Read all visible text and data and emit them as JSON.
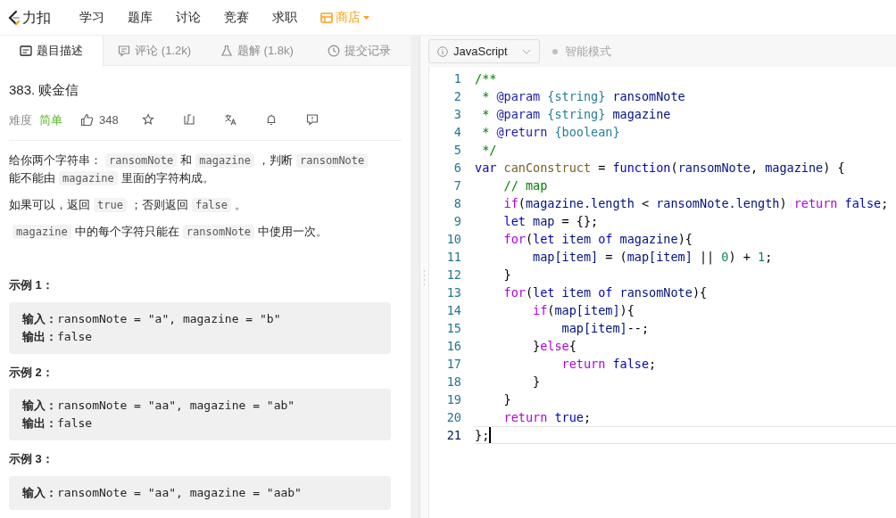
{
  "nav": {
    "logo": "力扣",
    "items": [
      {
        "label": "学习",
        "kind": "plain"
      },
      {
        "label": "题库",
        "kind": "plain"
      },
      {
        "label": "讨论",
        "kind": "plain"
      },
      {
        "label": "竞赛",
        "kind": "plain"
      },
      {
        "label": "求职",
        "kind": "plain"
      },
      {
        "label": "商店",
        "kind": "store"
      }
    ]
  },
  "tabs": [
    {
      "label": "题目描述",
      "selected": true
    },
    {
      "label": "评论 (1.2k)",
      "selected": false
    },
    {
      "label": "题解 (1.8k)",
      "selected": false
    },
    {
      "label": "提交记录",
      "selected": false
    }
  ],
  "editor_toolbar": {
    "language": "JavaScript",
    "mode": "智能模式"
  },
  "problem": {
    "title": "383. 赎金信",
    "difficulty_label": "难度",
    "difficulty": "简单",
    "likes": "348",
    "paragraphs": [
      [
        {
          "kind": "text",
          "text": "给你两个字符串："
        },
        {
          "kind": "code",
          "text": "ransomNote"
        },
        {
          "kind": "text",
          "text": "和"
        },
        {
          "kind": "code",
          "text": "magazine"
        },
        {
          "kind": "text",
          "text": "，判断"
        },
        {
          "kind": "code",
          "text": "ransomNote"
        },
        {
          "kind": "text",
          "text": "能不能由"
        },
        {
          "kind": "code",
          "text": "magazine"
        },
        {
          "kind": "text",
          "text": "里面的字符构成。"
        }
      ],
      [
        {
          "kind": "text",
          "text": "如果可以，返回"
        },
        {
          "kind": "code",
          "text": "true"
        },
        {
          "kind": "text",
          "text": "；否则返回"
        },
        {
          "kind": "code",
          "text": "false"
        },
        {
          "kind": "text",
          "text": "。"
        }
      ],
      [
        {
          "kind": "code",
          "text": "magazine"
        },
        {
          "kind": "text",
          "text": "中的每个字符只能在"
        },
        {
          "kind": "code",
          "text": "ransomNote"
        },
        {
          "kind": "text",
          "text": "中使用一次。"
        }
      ]
    ],
    "examples": [
      {
        "title": "示例 1：",
        "lines": [
          "**输入：**ransomNote = \"a\", magazine = \"b\"",
          "**输出：**false"
        ]
      },
      {
        "title": "示例 2：",
        "lines": [
          "**输入：**ransomNote = \"aa\", magazine = \"ab\"",
          "**输出：**false"
        ]
      },
      {
        "title": "示例 3：",
        "lines": [
          "**输入：**ransomNote = \"aa\", magazine = \"aab\""
        ]
      }
    ]
  },
  "code": [
    {
      "number": "1",
      "current": false,
      "tokens": [
        {
          "kind": "comment",
          "text": "/**"
        }
      ]
    },
    {
      "number": "2",
      "current": false,
      "tokens": [
        {
          "kind": "comment",
          "text": " * "
        },
        {
          "kind": "tag",
          "text": "@param "
        },
        {
          "kind": "type",
          "text": "{string} "
        },
        {
          "kind": "name",
          "text": "ransomNote"
        }
      ]
    },
    {
      "number": "3",
      "current": false,
      "tokens": [
        {
          "kind": "comment",
          "text": " * "
        },
        {
          "kind": "tag",
          "text": "@param "
        },
        {
          "kind": "type",
          "text": "{string} "
        },
        {
          "kind": "name",
          "text": "magazine"
        }
      ]
    },
    {
      "number": "4",
      "current": false,
      "tokens": [
        {
          "kind": "comment",
          "text": " * "
        },
        {
          "kind": "tag",
          "text": "@return "
        },
        {
          "kind": "type",
          "text": "{boolean}"
        }
      ]
    },
    {
      "number": "5",
      "current": false,
      "tokens": [
        {
          "kind": "comment",
          "text": " */"
        }
      ]
    },
    {
      "number": "6",
      "current": false,
      "tokens": [
        {
          "kind": "keyword",
          "text": "var "
        },
        {
          "kind": "function",
          "text": "canConstruct"
        },
        {
          "kind": "plain",
          "text": " = "
        },
        {
          "kind": "keyword",
          "text": "function"
        },
        {
          "kind": "plain",
          "text": "("
        },
        {
          "kind": "name",
          "text": "ransomNote"
        },
        {
          "kind": "plain",
          "text": ", "
        },
        {
          "kind": "name",
          "text": "magazine"
        },
        {
          "kind": "plain",
          "text": ") {"
        }
      ]
    },
    {
      "number": "7",
      "current": false,
      "tokens": [
        {
          "kind": "comment",
          "text": "    // map"
        }
      ]
    },
    {
      "number": "8",
      "current": false,
      "tokens": [
        {
          "kind": "control",
          "text": "    if"
        },
        {
          "kind": "plain",
          "text": "("
        },
        {
          "kind": "name",
          "text": "magazine.length"
        },
        {
          "kind": "plain",
          "text": " < "
        },
        {
          "kind": "name",
          "text": "ransomNote.length"
        },
        {
          "kind": "plain",
          "text": ") "
        },
        {
          "kind": "control",
          "text": "return "
        },
        {
          "kind": "keyword",
          "text": "false"
        },
        {
          "kind": "plain",
          "text": ";"
        }
      ]
    },
    {
      "number": "9",
      "current": false,
      "tokens": [
        {
          "kind": "keyword",
          "text": "    let "
        },
        {
          "kind": "name",
          "text": "map"
        },
        {
          "kind": "plain",
          "text": " = {};"
        }
      ]
    },
    {
      "number": "10",
      "current": false,
      "tokens": [
        {
          "kind": "control",
          "text": "    for"
        },
        {
          "kind": "plain",
          "text": "("
        },
        {
          "kind": "keyword",
          "text": "let "
        },
        {
          "kind": "name",
          "text": "item "
        },
        {
          "kind": "keyword",
          "text": "of "
        },
        {
          "kind": "name",
          "text": "magazine"
        },
        {
          "kind": "plain",
          "text": "){"
        }
      ]
    },
    {
      "number": "11",
      "current": false,
      "tokens": [
        {
          "kind": "name",
          "text": "        map[item]"
        },
        {
          "kind": "plain",
          "text": " = ("
        },
        {
          "kind": "name",
          "text": "map[item]"
        },
        {
          "kind": "plain",
          "text": " || "
        },
        {
          "kind": "number",
          "text": "0"
        },
        {
          "kind": "plain",
          "text": ") + "
        },
        {
          "kind": "number",
          "text": "1"
        },
        {
          "kind": "plain",
          "text": ";"
        }
      ]
    },
    {
      "number": "12",
      "current": false,
      "tokens": [
        {
          "kind": "plain",
          "text": "    }"
        }
      ]
    },
    {
      "number": "13",
      "current": false,
      "tokens": [
        {
          "kind": "control",
          "text": "    for"
        },
        {
          "kind": "plain",
          "text": "("
        },
        {
          "kind": "keyword",
          "text": "let "
        },
        {
          "kind": "name",
          "text": "item "
        },
        {
          "kind": "keyword",
          "text": "of "
        },
        {
          "kind": "name",
          "text": "ransomNote"
        },
        {
          "kind": "plain",
          "text": "){"
        }
      ]
    },
    {
      "number": "14",
      "current": false,
      "tokens": [
        {
          "kind": "control",
          "text": "        if"
        },
        {
          "kind": "plain",
          "text": "("
        },
        {
          "kind": "name",
          "text": "map[item]"
        },
        {
          "kind": "plain",
          "text": "){"
        }
      ]
    },
    {
      "number": "15",
      "current": false,
      "tokens": [
        {
          "kind": "name",
          "text": "            map[item]"
        },
        {
          "kind": "plain",
          "text": "--;"
        }
      ]
    },
    {
      "number": "16",
      "current": false,
      "tokens": [
        {
          "kind": "plain",
          "text": "        }"
        },
        {
          "kind": "control",
          "text": "else"
        },
        {
          "kind": "plain",
          "text": "{"
        }
      ]
    },
    {
      "number": "17",
      "current": false,
      "tokens": [
        {
          "kind": "control",
          "text": "            return "
        },
        {
          "kind": "keyword",
          "text": "false"
        },
        {
          "kind": "plain",
          "text": ";"
        }
      ]
    },
    {
      "number": "18",
      "current": false,
      "tokens": [
        {
          "kind": "plain",
          "text": "        }"
        }
      ]
    },
    {
      "number": "19",
      "current": false,
      "tokens": [
        {
          "kind": "plain",
          "text": "    }"
        }
      ]
    },
    {
      "number": "20",
      "current": false,
      "tokens": [
        {
          "kind": "control",
          "text": "    return "
        },
        {
          "kind": "keyword",
          "text": "true"
        },
        {
          "kind": "plain",
          "text": ";"
        }
      ]
    },
    {
      "number": "21",
      "current": true,
      "tokens": [
        {
          "kind": "plain",
          "text": "};"
        }
      ]
    }
  ]
}
